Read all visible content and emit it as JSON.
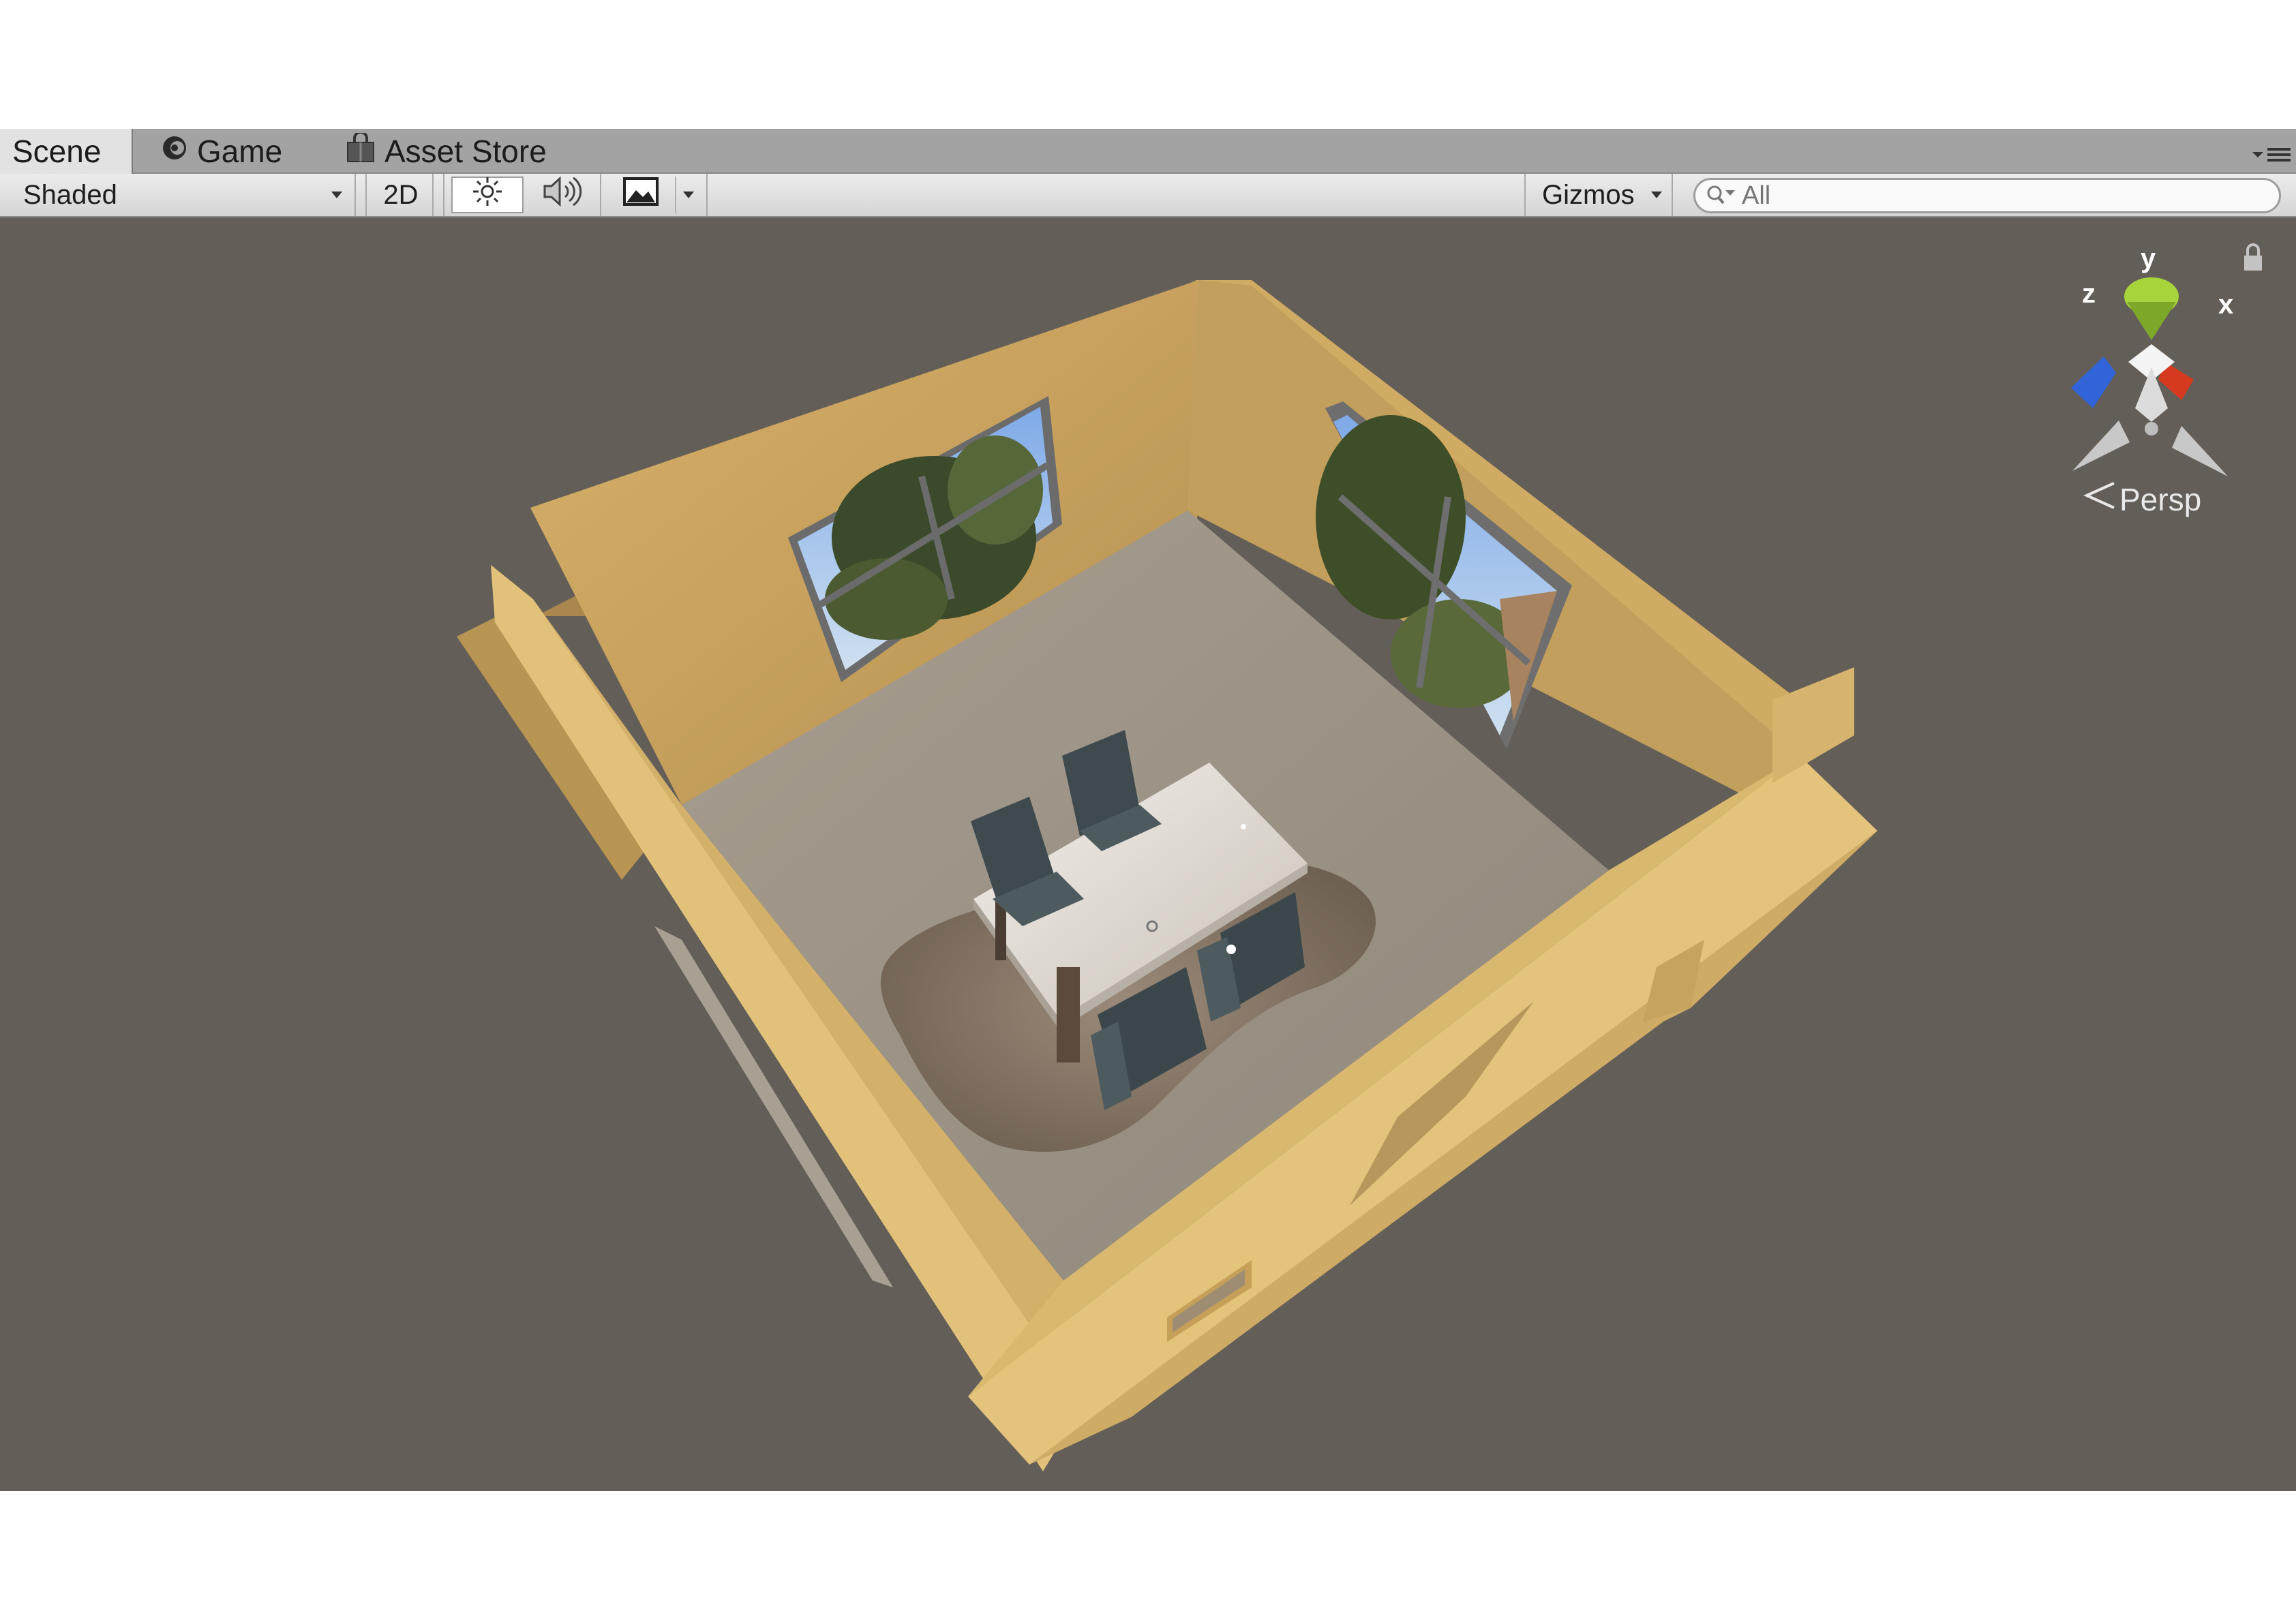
{
  "tabs": {
    "scene": "Scene",
    "game": "Game",
    "asset_store": "Asset Store"
  },
  "toolbar": {
    "shading_mode": "Shaded",
    "mode_2d": "2D",
    "gizmos": "Gizmos",
    "search_placeholder": "All"
  },
  "viewport": {
    "axis_y": "y",
    "axis_z": "z",
    "axis_x": "x",
    "projection": "Persp"
  },
  "colors": {
    "viewport_bg": "#645e58",
    "wall": "#c9a35a",
    "floor": "#948b7e",
    "axis_x": "#d63a1e",
    "axis_y": "#9ccc2e",
    "axis_z": "#3064d8"
  },
  "icons": [
    "unity-logo-icon",
    "shopping-bag-icon",
    "tab-menu-icon",
    "sun-icon",
    "speaker-icon",
    "image-icon",
    "search-icon",
    "lock-icon",
    "persp-arrow-icon"
  ]
}
